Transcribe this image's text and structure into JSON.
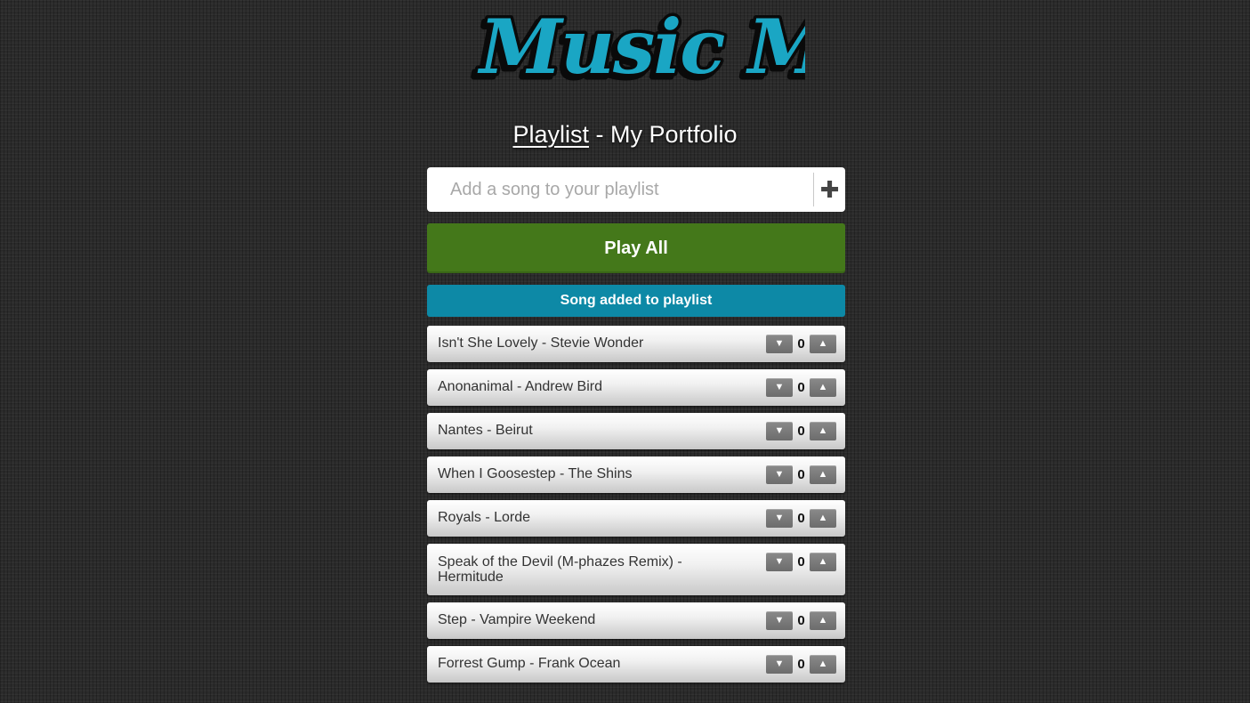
{
  "logo": {
    "text": "Music Me",
    "fill_color": "#1aa6c4",
    "outline_color": "#0a0a0a"
  },
  "header": {
    "title_link": "Playlist",
    "title_separator": " - ",
    "title_name": "My Portfolio"
  },
  "add_song": {
    "placeholder": "Add a song to your playlist",
    "button_icon": "plus-icon",
    "button_glyph": "✚"
  },
  "play_all": {
    "label": "Play All",
    "color": "#44781a"
  },
  "notice": {
    "text": "Song added to playlist",
    "color": "#0d89a6"
  },
  "vote_icons": {
    "down": "▼",
    "up": "▲"
  },
  "songs": [
    {
      "title": "Isn't She Lovely - Stevie Wonder",
      "votes": "0"
    },
    {
      "title": "Anonanimal - Andrew Bird",
      "votes": "0"
    },
    {
      "title": "Nantes - Beirut",
      "votes": "0"
    },
    {
      "title": "When I Goosestep - The Shins",
      "votes": "0"
    },
    {
      "title": "Royals - Lorde",
      "votes": "0"
    },
    {
      "title": "Speak of the Devil (M-phazes Remix) - Hermitude",
      "votes": "0"
    },
    {
      "title": "Step - Vampire Weekend",
      "votes": "0"
    },
    {
      "title": "Forrest Gump - Frank Ocean",
      "votes": "0"
    }
  ]
}
